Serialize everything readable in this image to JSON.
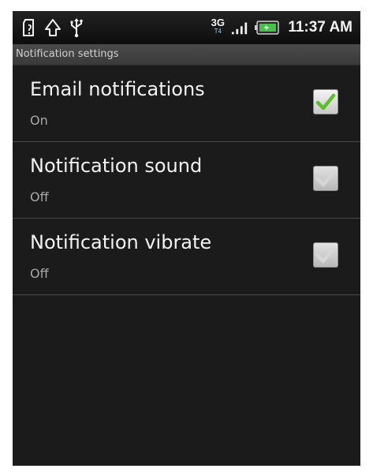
{
  "status_bar": {
    "icons": [
      "sd-card-icon",
      "upload-icon",
      "usb-icon"
    ],
    "network_type": "3G",
    "network_subtype": "T4",
    "time": "11:37 AM",
    "battery_color": "#46c24a"
  },
  "screen": {
    "title": "Notification settings"
  },
  "settings": [
    {
      "label": "Email notifications",
      "summary": "On",
      "checked": true
    },
    {
      "label": "Notification sound",
      "summary": "Off",
      "checked": false
    },
    {
      "label": "Notification vibrate",
      "summary": "Off",
      "checked": false
    }
  ],
  "colors": {
    "check_on": "#5cbf2a",
    "check_off": "#d7d7d7"
  }
}
